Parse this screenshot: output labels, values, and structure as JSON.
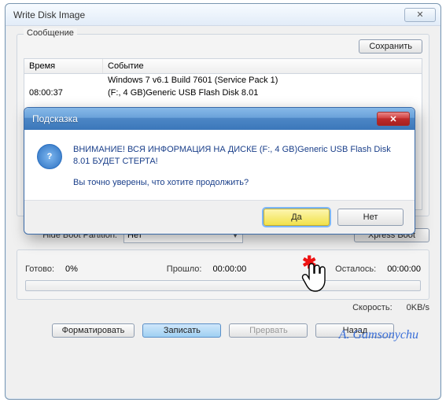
{
  "window": {
    "title": "Write Disk Image",
    "close_glyph": "✕"
  },
  "messages": {
    "legend": "Сообщение",
    "save_btn": "Сохранить",
    "col_time": "Время",
    "col_event": "Событие",
    "rows": [
      {
        "time": "",
        "event": "Windows 7 v6.1 Build 7601 (Service Pack 1)"
      },
      {
        "time": "08:00:37",
        "event": "(F:, 4 GB)Generic USB Flash Disk  8.01"
      }
    ]
  },
  "form": {
    "hide_boot_label": "Hide Boot Partition:",
    "hide_boot_value": "Нет",
    "xpress_btn": "Xpress Boot"
  },
  "progress": {
    "ready_label": "Готово:",
    "ready_value": "0%",
    "elapsed_label": "Прошло:",
    "elapsed_value": "00:00:00",
    "remain_label": "Осталось:",
    "remain_value": "00:00:00"
  },
  "status": {
    "speed_label": "Скорость:",
    "speed_value": "0KB/s"
  },
  "buttons": {
    "format": "Форматировать",
    "write": "Записать",
    "abort": "Прервать",
    "back": "Назад"
  },
  "watermark": "A. Gamsonychu",
  "dialog": {
    "title": "Подсказка",
    "close_glyph": "✕",
    "icon_glyph": "?",
    "warning": "ВНИМАНИЕ! ВСЯ ИНФОРМАЦИЯ НА ДИСКЕ (F:, 4 GB)Generic USB Flash Disk  8.01 БУДЕТ СТЕРТА!",
    "question": "Вы точно уверены, что хотите продолжить?",
    "yes": "Да",
    "no": "Нет"
  }
}
